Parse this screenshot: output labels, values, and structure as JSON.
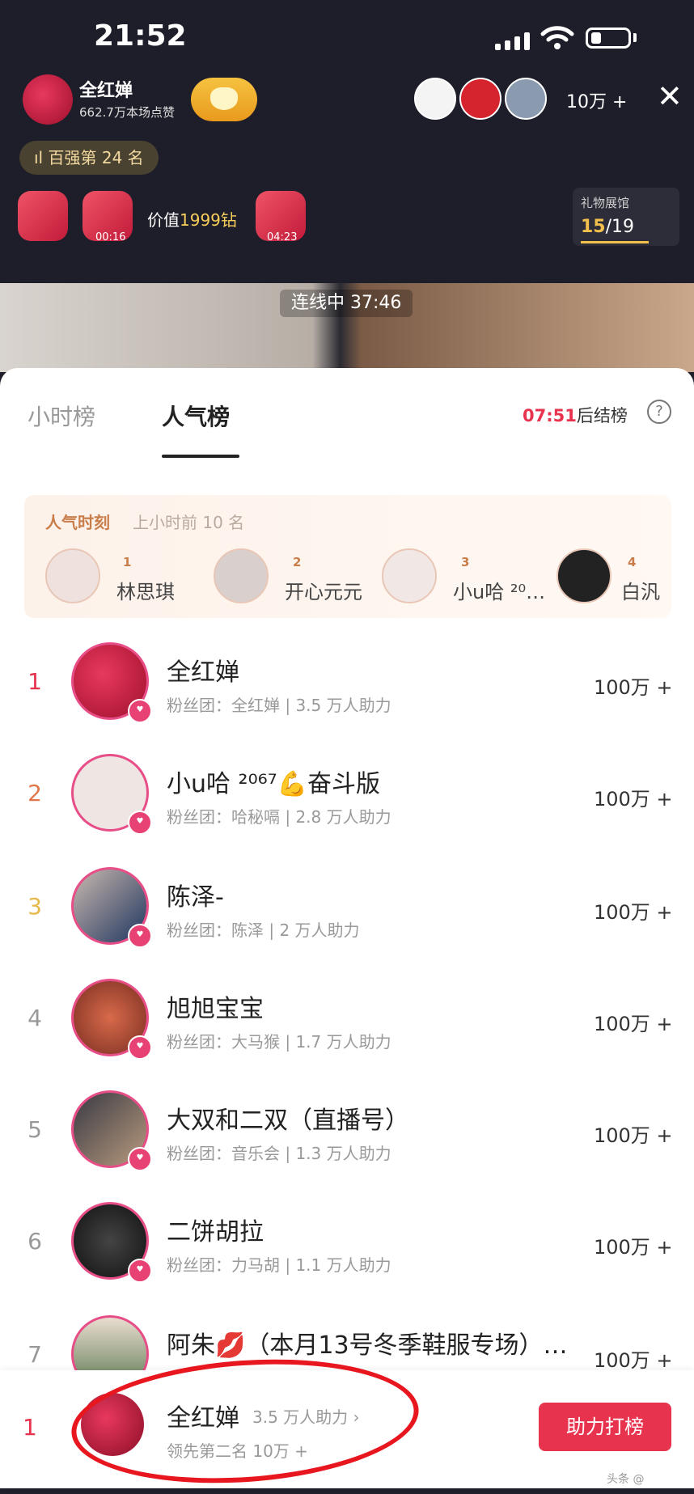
{
  "status_bar": {
    "time": "21:52"
  },
  "host": {
    "name": "全红婵",
    "likes": "662.7万本场点赞"
  },
  "viewers": {
    "count": "10万 +"
  },
  "rank_badge": {
    "icon": "bar-chart-icon",
    "text": "百强第 24 名"
  },
  "gifts": {
    "timer1": "00:16",
    "value_prefix": "价值",
    "value_amount": "1999钻",
    "timer2": "04:23"
  },
  "gallery": {
    "title": "礼物展馆",
    "current": "15",
    "total": "/19"
  },
  "video": {
    "pk_timer": "连线中 37:46"
  },
  "tabs": [
    {
      "label": "小时榜"
    },
    {
      "label": "人气榜"
    }
  ],
  "countdown": {
    "time": "07:51",
    "suffix": "后结榜"
  },
  "moments": {
    "title": "人气时刻",
    "subtitle": "上小时前 10 名",
    "items": [
      {
        "rank": "1",
        "name": "林思琪"
      },
      {
        "rank": "2",
        "name": "开心元元"
      },
      {
        "rank": "3",
        "name": "小u哈 ²⁰…"
      },
      {
        "rank": "4",
        "name": "白汎"
      }
    ]
  },
  "rankings": [
    {
      "rank": "1",
      "name": "全红婵",
      "fan": "粉丝团：全红婵 | 3.5 万人助力",
      "score": "100万 +"
    },
    {
      "rank": "2",
      "name": "小u哈 ²⁰⁶⁷💪奋斗版",
      "fan": "粉丝团：哈秘嗝 | 2.8 万人助力",
      "score": "100万 +"
    },
    {
      "rank": "3",
      "name": "陈泽-",
      "fan": "粉丝团：陈泽 | 2 万人助力",
      "score": "100万 +"
    },
    {
      "rank": "4",
      "name": "旭旭宝宝",
      "fan": "粉丝团：大马猴 | 1.7 万人助力",
      "score": "100万 +"
    },
    {
      "rank": "5",
      "name": "大双和二双（直播号）",
      "fan": "粉丝团：音乐会 | 1.3 万人助力",
      "score": "100万 +"
    },
    {
      "rank": "6",
      "name": "二饼胡拉",
      "fan": "粉丝团：力马胡 | 1.1 万人助力",
      "score": "100万 +"
    },
    {
      "rank": "7",
      "name": "阿朱💋（本月13号冬季鞋服专场）…",
      "fan": "",
      "score": "100万 +"
    }
  ],
  "bottom": {
    "rank": "1",
    "name": "全红婵",
    "help": "3.5 万人助力 ›",
    "lead": "领先第二名 10万 +",
    "button": "助力打榜",
    "watermark": "头条 @"
  },
  "colors": {
    "accent": "#e8334f",
    "gold": "#f3c04c"
  }
}
